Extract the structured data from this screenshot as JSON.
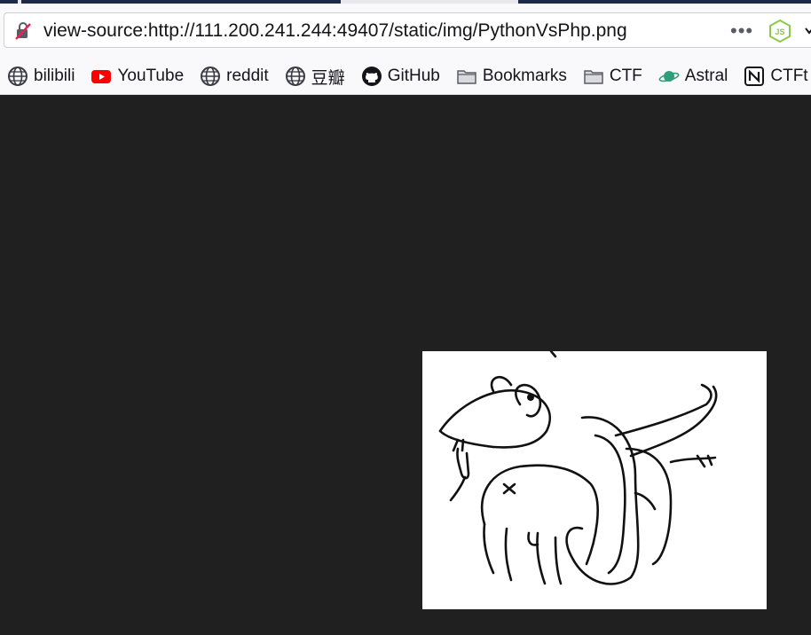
{
  "browser": {
    "url": "view-source:http://111.200.241.244:49407/static/img/PythonVsPhp.png",
    "icons": {
      "security": "insecure-lock-icon",
      "more": "more-actions-icon",
      "extension": "nodejs-extension-icon"
    }
  },
  "bookmarks": [
    {
      "label": "bilibili",
      "icon": "globe-icon"
    },
    {
      "label": "YouTube",
      "icon": "youtube-icon"
    },
    {
      "label": "reddit",
      "icon": "globe-icon"
    },
    {
      "label": "豆瓣",
      "icon": "globe-icon"
    },
    {
      "label": "GitHub",
      "icon": "github-icon"
    },
    {
      "label": "Bookmarks",
      "icon": "folder-icon"
    },
    {
      "label": "CTF",
      "icon": "folder-icon"
    },
    {
      "label": "Astral",
      "icon": "planet-icon"
    },
    {
      "label": "CTFt",
      "icon": "notion-icon"
    }
  ],
  "page": {
    "image_name": "PythonVsPhp.png",
    "image_description_icon": "python-vs-php-drawing"
  },
  "colors": {
    "page_background": "#202020",
    "toolbar_background": "#f9f9fb",
    "youtube_red": "#ff0000",
    "node_green": "#8cc84b",
    "astral_green": "#2e9e7a"
  }
}
